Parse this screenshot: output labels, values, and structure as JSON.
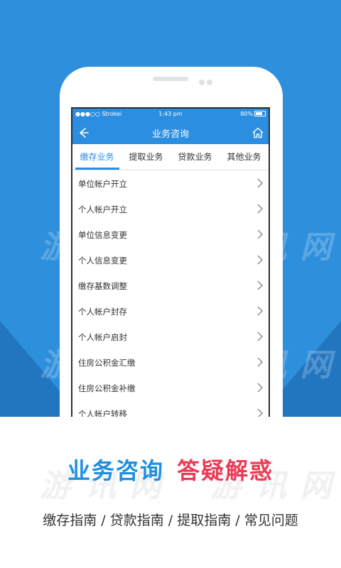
{
  "status_bar": {
    "carrier": "●●●○○ Strokei",
    "time": "1:43 pm",
    "battery": "80%"
  },
  "nav": {
    "title": "业务咨询"
  },
  "tabs": [
    {
      "label": "缴存业务",
      "active": true
    },
    {
      "label": "提取业务",
      "active": false
    },
    {
      "label": "贷款业务",
      "active": false
    },
    {
      "label": "其他业务",
      "active": false
    }
  ],
  "list": [
    {
      "label": "单位帐户开立"
    },
    {
      "label": "个人帐户开立"
    },
    {
      "label": "单位信息变更"
    },
    {
      "label": "个人信息变更"
    },
    {
      "label": "缴存基数调整"
    },
    {
      "label": "个人帐户封存"
    },
    {
      "label": "个人帐户启封"
    },
    {
      "label": "住房公积金汇缴"
    },
    {
      "label": "住房公积金补缴"
    },
    {
      "label": "个人帐户转移"
    }
  ],
  "promo": {
    "headline_blue": "业务咨询",
    "headline_red": "答疑解惑",
    "subline": "缴存指南 / 贷款指南 / 提取指南 / 常见问题"
  },
  "watermark": "游 讯 网",
  "colors": {
    "background_blue": "#2e8fdc",
    "accent": "#2b8ee0",
    "headline_red": "#ec3b56"
  }
}
